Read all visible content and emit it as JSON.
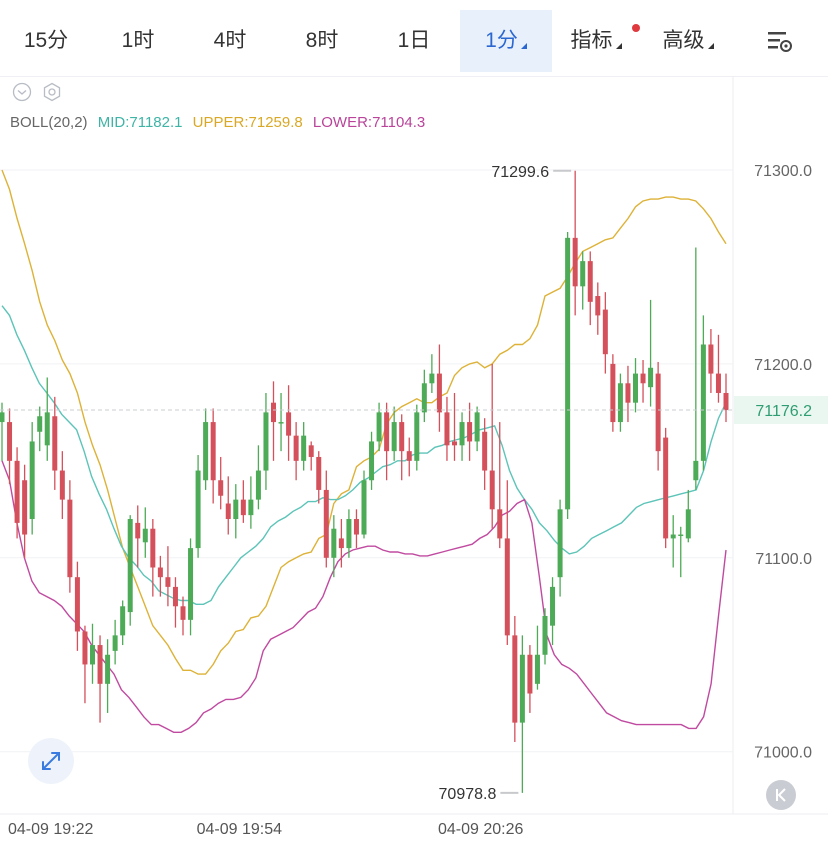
{
  "tabs": [
    {
      "label": "15分",
      "active": false,
      "dropdown": false
    },
    {
      "label": "1时",
      "active": false,
      "dropdown": false
    },
    {
      "label": "4时",
      "active": false,
      "dropdown": false
    },
    {
      "label": "8时",
      "active": false,
      "dropdown": false
    },
    {
      "label": "1日",
      "active": false,
      "dropdown": false
    },
    {
      "label": "1分",
      "active": true,
      "dropdown": true
    },
    {
      "label": "指标",
      "active": false,
      "dropdown": true,
      "badge": true
    },
    {
      "label": "高级",
      "active": false,
      "dropdown": true
    }
  ],
  "icons": {
    "settings": "chart-settings-icon",
    "collapse": "chevron-down-circle-icon",
    "gear": "hexagon-gear-icon",
    "expand": "expand-arrows-icon",
    "back": "scroll-to-latest-icon"
  },
  "indicator": {
    "name": "BOLL(20,2)",
    "mid": "MID:71182.1",
    "upper": "UPPER:71259.8",
    "lower": "LOWER:71104.3"
  },
  "colors": {
    "up": "#4daa56",
    "down": "#d4505b",
    "mid": "#5cc4b8",
    "upper": "#ddb237",
    "lower": "#c04aa0",
    "current": "#2e9e72",
    "accent": "#2b67d1"
  },
  "chart_data": {
    "type": "candlestick",
    "y_ticks": [
      "71300.0",
      "71200.0",
      "71100.0",
      "71000.0"
    ],
    "ylim": [
      70972,
      71333
    ],
    "x_labels": [
      "04-09 19:22",
      "04-09 19:54",
      "04-09 20:26"
    ],
    "current_price": "71176.2",
    "high_marker": "71299.6",
    "low_marker": "70978.8",
    "candles": [
      [
        71170,
        71175,
        71150,
        71180
      ],
      [
        71170,
        71150,
        71138,
        71177
      ],
      [
        71150,
        71118,
        71110,
        71157
      ],
      [
        71140,
        71112,
        71100,
        71148
      ],
      [
        71120,
        71160,
        71112,
        71170
      ],
      [
        71165,
        71173,
        71155,
        71178
      ],
      [
        71158,
        71175,
        71150,
        71193
      ],
      [
        71173,
        71145,
        71135,
        71183
      ],
      [
        71145,
        71130,
        71120,
        71155
      ],
      [
        71130,
        71090,
        71082,
        71140
      ],
      [
        71090,
        71062,
        71052,
        71098
      ],
      [
        71062,
        71045,
        71025,
        71065
      ],
      [
        71045,
        71055,
        71035,
        71066
      ],
      [
        71055,
        71035,
        71015,
        71060
      ],
      [
        71035,
        71050,
        71020,
        71058
      ],
      [
        71052,
        71060,
        71045,
        71068
      ],
      [
        71060,
        71075,
        71055,
        71078
      ],
      [
        71072,
        71120,
        71065,
        71122
      ],
      [
        71118,
        71110,
        71095,
        71127
      ],
      [
        71108,
        71115,
        71100,
        71126
      ],
      [
        71115,
        71095,
        71080,
        71120
      ],
      [
        71095,
        71090,
        71080,
        71101
      ],
      [
        71090,
        71085,
        71075,
        71106
      ],
      [
        71085,
        71075,
        71064,
        71090
      ],
      [
        71075,
        71068,
        71060,
        71080
      ],
      [
        71068,
        71105,
        71060,
        71110
      ],
      [
        71105,
        71145,
        71100,
        71153
      ],
      [
        71140,
        71170,
        71135,
        71177
      ],
      [
        71170,
        71140,
        71128,
        71177
      ],
      [
        71140,
        71132,
        71125,
        71152
      ],
      [
        71128,
        71120,
        71112,
        71142
      ],
      [
        71120,
        71130,
        71110,
        71138
      ],
      [
        71130,
        71122,
        71118,
        71140
      ],
      [
        71122,
        71130,
        71115,
        71142
      ],
      [
        71130,
        71145,
        71125,
        71158
      ],
      [
        71145,
        71175,
        71135,
        71185
      ],
      [
        71180,
        71170,
        71150,
        71191
      ],
      [
        71170,
        71170,
        71155,
        71185
      ],
      [
        71175,
        71163,
        71150,
        71189
      ],
      [
        71163,
        71150,
        71140,
        71170
      ],
      [
        71150,
        71163,
        71145,
        71170
      ],
      [
        71158,
        71152,
        71145,
        71160
      ],
      [
        71152,
        71135,
        71128,
        71155
      ],
      [
        71135,
        71100,
        71095,
        71145
      ],
      [
        71100,
        71115,
        71090,
        71122
      ],
      [
        71110,
        71105,
        71095,
        71120
      ],
      [
        71105,
        71120,
        71100,
        71125
      ],
      [
        71120,
        71112,
        71105,
        71125
      ],
      [
        71112,
        71140,
        71110,
        71145
      ],
      [
        71140,
        71160,
        71135,
        71165
      ],
      [
        71160,
        71175,
        71155,
        71180
      ],
      [
        71175,
        71155,
        71140,
        71180
      ],
      [
        71155,
        71170,
        71150,
        71178
      ],
      [
        71170,
        71155,
        71140,
        71174
      ],
      [
        71155,
        71150,
        71142,
        71162
      ],
      [
        71150,
        71175,
        71145,
        71179
      ],
      [
        71175,
        71190,
        71170,
        71197
      ],
      [
        71190,
        71195,
        71185,
        71205
      ],
      [
        71195,
        71175,
        71165,
        71210
      ],
      [
        71175,
        71158,
        71150,
        71183
      ],
      [
        71160,
        71158,
        71150,
        71185
      ],
      [
        71158,
        71170,
        71150,
        71175
      ],
      [
        71170,
        71160,
        71150,
        71180
      ],
      [
        71160,
        71175,
        71155,
        71178
      ],
      [
        71165,
        71145,
        71135,
        71172
      ],
      [
        71145,
        71125,
        71115,
        71200
      ],
      [
        71125,
        71110,
        71105,
        71170
      ],
      [
        71110,
        71060,
        71055,
        71140
      ],
      [
        71060,
        71015,
        71005,
        71070
      ],
      [
        71015,
        71050,
        70978.8,
        71060
      ],
      [
        71050,
        71030,
        71020,
        71055
      ],
      [
        71035,
        71050,
        71032,
        71065
      ],
      [
        71050,
        71070,
        71045,
        71074
      ],
      [
        71065,
        71085,
        71055,
        71090
      ],
      [
        71090,
        71125,
        71080,
        71130
      ],
      [
        71125,
        71265,
        71120,
        71268
      ],
      [
        71265,
        71240,
        71225,
        71299.6
      ],
      [
        71240,
        71253,
        71228,
        71258
      ],
      [
        71253,
        71232,
        71220,
        71258
      ],
      [
        71235,
        71225,
        71215,
        71242
      ],
      [
        71228,
        71205,
        71195,
        71237
      ],
      [
        71200,
        71170,
        71165,
        71205
      ],
      [
        71170,
        71190,
        71165,
        71195
      ],
      [
        71190,
        71180,
        71170,
        71199
      ],
      [
        71180,
        71195,
        71175,
        71203
      ],
      [
        71195,
        71190,
        71180,
        71202
      ],
      [
        71188,
        71198,
        71178,
        71233
      ],
      [
        71195,
        71155,
        71145,
        71201
      ],
      [
        71162,
        71110,
        71105,
        71167
      ],
      [
        71110,
        71112,
        71095,
        71122
      ],
      [
        71112,
        71112,
        71090,
        71116
      ],
      [
        71110,
        71125,
        71108,
        71135
      ],
      [
        71140,
        71150,
        71135,
        71260
      ],
      [
        71150,
        71210,
        71145,
        71225
      ],
      [
        71210,
        71195,
        71185,
        71218
      ],
      [
        71195,
        71185,
        71180,
        71215
      ],
      [
        71185,
        71176.2,
        71170,
        71195
      ]
    ],
    "series": [
      {
        "name": "UPPER",
        "values": [
          71300,
          71290,
          71275,
          71262,
          71248,
          71232,
          71220,
          71212,
          71202,
          71195,
          71185,
          71170,
          71158,
          71148,
          71135,
          71120,
          71105,
          71095,
          71085,
          71075,
          71065,
          71060,
          71055,
          71048,
          71042,
          71042,
          71040,
          71040,
          71045,
          71052,
          71056,
          71062,
          71063,
          71069,
          71070,
          71075,
          71085,
          71095,
          71098,
          71100,
          71102,
          71103,
          71110,
          71112,
          71128,
          71133,
          71135,
          71147,
          71150,
          71152,
          71156,
          71169,
          71175,
          71178,
          71180,
          71182,
          71180,
          71180,
          71183,
          71185,
          71194,
          71198,
          71200,
          71201,
          71198,
          71200,
          71205,
          71207,
          71210,
          71210,
          71213,
          71220,
          71235,
          71237,
          71239,
          71245,
          71252,
          71258,
          71260,
          71262,
          71264,
          71265,
          71270,
          71275,
          71281,
          71284,
          71285,
          71285,
          71286,
          71286,
          71285,
          71285,
          71284,
          71280,
          71275,
          71268,
          71262
        ]
      },
      {
        "name": "MID",
        "values": [
          71230,
          71225,
          71215,
          71207,
          71198,
          71190,
          71185,
          71180,
          71174,
          71170,
          71166,
          71155,
          71142,
          71133,
          71125,
          71115,
          71106,
          71100,
          71096,
          71091,
          71088,
          71083,
          71081,
          71079,
          71078,
          71078,
          71076,
          71076,
          71078,
          71085,
          71090,
          71095,
          71100,
          71103,
          71106,
          71110,
          71116,
          71119,
          71121,
          71124,
          71126,
          71129,
          71129,
          71131,
          71130,
          71130,
          71132,
          71135,
          71139,
          71141,
          71144,
          71147,
          71148,
          71150,
          71150,
          71153,
          71154,
          71154,
          71157,
          71158,
          71160,
          71161,
          71162,
          71164,
          71166,
          71167,
          71168,
          71158,
          71145,
          71136,
          71130,
          71125,
          71118,
          71114,
          71109,
          71105,
          71102,
          71103,
          71106,
          71110,
          71112,
          71114,
          71116,
          71118,
          71122,
          71126,
          71128,
          71129,
          71130,
          71131,
          71132,
          71133,
          71134,
          71135,
          71145,
          71160,
          71172,
          71180
        ]
      },
      {
        "name": "LOWER",
        "values": [
          71150,
          71140,
          71118,
          71100,
          71088,
          71082,
          71080,
          71078,
          71075,
          71070,
          71066,
          71062,
          71055,
          71050,
          71045,
          71040,
          71032,
          71028,
          71023,
          71018,
          71014,
          71014,
          71012,
          71010,
          71010,
          71012,
          71015,
          71020,
          71022,
          71025,
          71027,
          71027,
          71028,
          71032,
          71038,
          71052,
          71058,
          71060,
          71062,
          71064,
          71068,
          71072,
          71074,
          71080,
          71090,
          71098,
          71102,
          71104,
          71105,
          71106,
          71106,
          71104,
          71103,
          71103,
          71102,
          71102,
          71101,
          71101,
          71102,
          71103,
          71104,
          71105,
          71106,
          71107,
          71110,
          71112,
          71116,
          71122,
          71124,
          71128,
          71130,
          71118,
          71090,
          71060,
          71050,
          71045,
          71043,
          71040,
          71035,
          71030,
          71025,
          71020,
          71018,
          71016,
          71015,
          71014,
          71014,
          71014,
          71014,
          71014,
          71014,
          71014,
          71012,
          71012,
          71018,
          71035,
          71070,
          71104
        ]
      }
    ]
  }
}
